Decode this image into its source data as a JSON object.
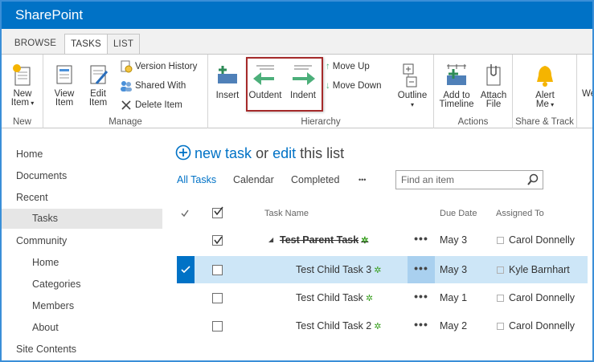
{
  "suite": {
    "title": "SharePoint"
  },
  "tabs": [
    {
      "label": "BROWSE"
    },
    {
      "label": "TASKS"
    },
    {
      "label": "LIST"
    }
  ],
  "ribbon": {
    "new_group": {
      "label": "New",
      "new_item_line1": "New",
      "new_item_line2": "Item"
    },
    "manage_group": {
      "label": "Manage",
      "view_item_line1": "View",
      "view_item_line2": "Item",
      "edit_item_line1": "Edit",
      "edit_item_line2": "Item",
      "version_history": "Version History",
      "shared_with": "Shared With",
      "delete_item": "Delete Item"
    },
    "hierarchy_group": {
      "label": "Hierarchy",
      "insert": "Insert",
      "outdent": "Outdent",
      "indent": "Indent",
      "move_up": "Move Up",
      "move_down": "Move Down",
      "outline": "Outline"
    },
    "actions_group": {
      "label": "Actions",
      "add_to_timeline_line1": "Add to",
      "add_to_timeline_line2": "Timeline",
      "attach_file_line1": "Attach",
      "attach_file_line2": "File"
    },
    "share_group": {
      "label": "Share & Track",
      "alert_me_line1": "Alert",
      "alert_me_line2": "Me",
      "cut_label": "We"
    }
  },
  "nav": {
    "home": "Home",
    "documents": "Documents",
    "recent": "Recent",
    "tasks": "Tasks",
    "community": "Community",
    "community_home": "Home",
    "categories": "Categories",
    "members": "Members",
    "about": "About",
    "site_contents": "Site Contents"
  },
  "main": {
    "new_task": "new task",
    "or": "or",
    "edit": "edit",
    "this_list": "this list",
    "views": {
      "all_tasks": "All Tasks",
      "calendar": "Calendar",
      "completed": "Completed",
      "more": "•••"
    },
    "search_placeholder": "Find an item",
    "headers": {
      "task_name": "Task Name",
      "due_date": "Due Date",
      "assigned_to": "Assigned To"
    },
    "rows": [
      {
        "task": "Test Parent Task",
        "due": "May 3",
        "assigned": "Carol Donnelly",
        "completed": true,
        "selected": false
      },
      {
        "task": "Test Child Task 3",
        "due": "May 3",
        "assigned": "Kyle Barnhart",
        "completed": false,
        "selected": true
      },
      {
        "task": "Test Child Task",
        "due": "May 1",
        "assigned": "Carol Donnelly",
        "completed": false,
        "selected": false
      },
      {
        "task": "Test Child Task 2",
        "due": "May 2",
        "assigned": "Carol Donnelly",
        "completed": false,
        "selected": false
      }
    ],
    "ellipsis": "•••",
    "star": "✲"
  },
  "colors": {
    "accent": "#0072c6",
    "selected_row": "#cde6f7",
    "highlight_box": "#a52a2a",
    "indent_arrow": "#4caf7a"
  }
}
